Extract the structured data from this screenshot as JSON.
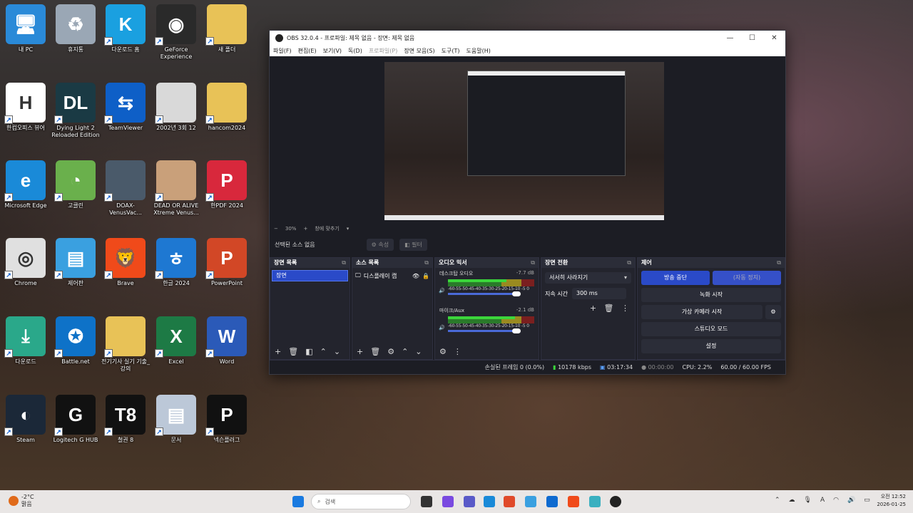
{
  "desktop": {
    "icons": [
      {
        "label": "내 PC",
        "glyph": "🖥",
        "bg": "#2a8ad8"
      },
      {
        "label": "휴지통",
        "glyph": "♻",
        "bg": "#9aa7b5"
      },
      {
        "label": "다운로드 홈",
        "glyph": "K",
        "bg": "#1aa0e0"
      },
      {
        "label": "GeForce Experience",
        "glyph": "◉",
        "bg": "#2a2a2a"
      },
      {
        "label": "새 폴더",
        "glyph": "",
        "bg": "#e8c257"
      },
      {
        "label": "한컴오피스 뷰어",
        "glyph": "H",
        "bg": "#ffffff"
      },
      {
        "label": "Dying Light 2 Reloaded Edition",
        "glyph": "DL",
        "bg": "#1a3a44"
      },
      {
        "label": "TeamViewer",
        "glyph": "⇆",
        "bg": "#0e5fc7"
      },
      {
        "label": "2002년 3회 12",
        "glyph": "",
        "bg": "#d9d9d9"
      },
      {
        "label": "hancom2024",
        "glyph": "",
        "bg": "#e8c257"
      },
      {
        "label": "Microsoft Edge",
        "glyph": "e",
        "bg": "#1a8ad8"
      },
      {
        "label": "고클린",
        "glyph": "◔",
        "bg": "#6ab04c"
      },
      {
        "label": "DOAX-VenusVac...",
        "glyph": "",
        "bg": "#4a5a6a"
      },
      {
        "label": "DEAD OR ALIVE Xtreme Venus...",
        "glyph": "",
        "bg": "#c9a07a"
      },
      {
        "label": "한PDF 2024",
        "glyph": "P",
        "bg": "#d8283c"
      },
      {
        "label": "Chrome",
        "glyph": "◎",
        "bg": "#e0e0e0"
      },
      {
        "label": "제어판",
        "glyph": "▤",
        "bg": "#3aa0e0"
      },
      {
        "label": "Brave",
        "glyph": "🦁",
        "bg": "#f04a1a"
      },
      {
        "label": "한글 2024",
        "glyph": "ㅎ",
        "bg": "#1e78d2"
      },
      {
        "label": "PowerPoint",
        "glyph": "P",
        "bg": "#d24726"
      },
      {
        "label": "다운로드",
        "glyph": "⤓",
        "bg": "#2aa88a"
      },
      {
        "label": "Battle.net",
        "glyph": "✪",
        "bg": "#0e72c8"
      },
      {
        "label": "전기기사 실기 기출_강의",
        "glyph": "",
        "bg": "#e8c257"
      },
      {
        "label": "Excel",
        "glyph": "X",
        "bg": "#1d7a45"
      },
      {
        "label": "Word",
        "glyph": "W",
        "bg": "#2b5ab8"
      },
      {
        "label": "Steam",
        "glyph": "◐",
        "bg": "#1b2838"
      },
      {
        "label": "Logitech G HUB",
        "glyph": "G",
        "bg": "#111111"
      },
      {
        "label": "철권 8",
        "glyph": "T8",
        "bg": "#111111"
      },
      {
        "label": "문서",
        "glyph": "▤",
        "bg": "#bcc8d8"
      },
      {
        "label": "넥슨플러그",
        "glyph": "P",
        "bg": "#111111"
      }
    ]
  },
  "obs": {
    "title": "OBS 32.0.4 - 프로파일: 제목 없음 - 장면: 제목 없음",
    "menu": [
      "파일(F)",
      "편집(E)",
      "보기(V)",
      "독(D)",
      "프로파일(P)",
      "장면 모음(S)",
      "도구(T)",
      "도움말(H)"
    ],
    "zoom": {
      "minus": "−",
      "value": "30%",
      "plus": "+",
      "fit": "창에 맞추기"
    },
    "context": {
      "no_source": "선택된 소스 없음",
      "properties": "속성",
      "filters": "필터"
    },
    "scenes": {
      "title": "장면 목록",
      "items": [
        "장면"
      ]
    },
    "sources": {
      "title": "소스 목록",
      "items": [
        "디스플레이 캡"
      ]
    },
    "mixer": {
      "title": "오디오 믹서",
      "channels": [
        {
          "name": "데스크탑 오디오",
          "db": "-7.7 dB",
          "level": 0.68
        },
        {
          "name": "마이크/Aux",
          "db": "-2.1 dB",
          "level": 0.78
        }
      ],
      "scale": "-60-55-50-45-40-35-30-25-20-15-10 -5  0"
    },
    "transitions": {
      "title": "장면 전환",
      "selected": "서서히 사라지기",
      "duration_label": "지속 시간",
      "duration": "300 ms"
    },
    "controls": {
      "title": "제어",
      "stop_stream": "방송 중단",
      "stop_auto": "(자동 정지)",
      "record": "녹화 시작",
      "virtual_cam": "가상 카메라 시작",
      "studio": "스튜디오 모드",
      "settings": "설정"
    },
    "status": {
      "dropped": "손실된 프레임 0 (0.0%)",
      "bitrate": "10178 kbps",
      "stream_time": "03:17:34",
      "rec_time": "00:00:00",
      "cpu": "CPU: 2.2%",
      "fps": "60.00 / 60.00 FPS"
    }
  },
  "taskbar": {
    "weather": {
      "temp": "-2°C",
      "cond": "맑음"
    },
    "search_placeholder": "검색",
    "clock": {
      "time": "오전 12:52",
      "date": "2026-01-25"
    },
    "tray_lang": "A"
  }
}
